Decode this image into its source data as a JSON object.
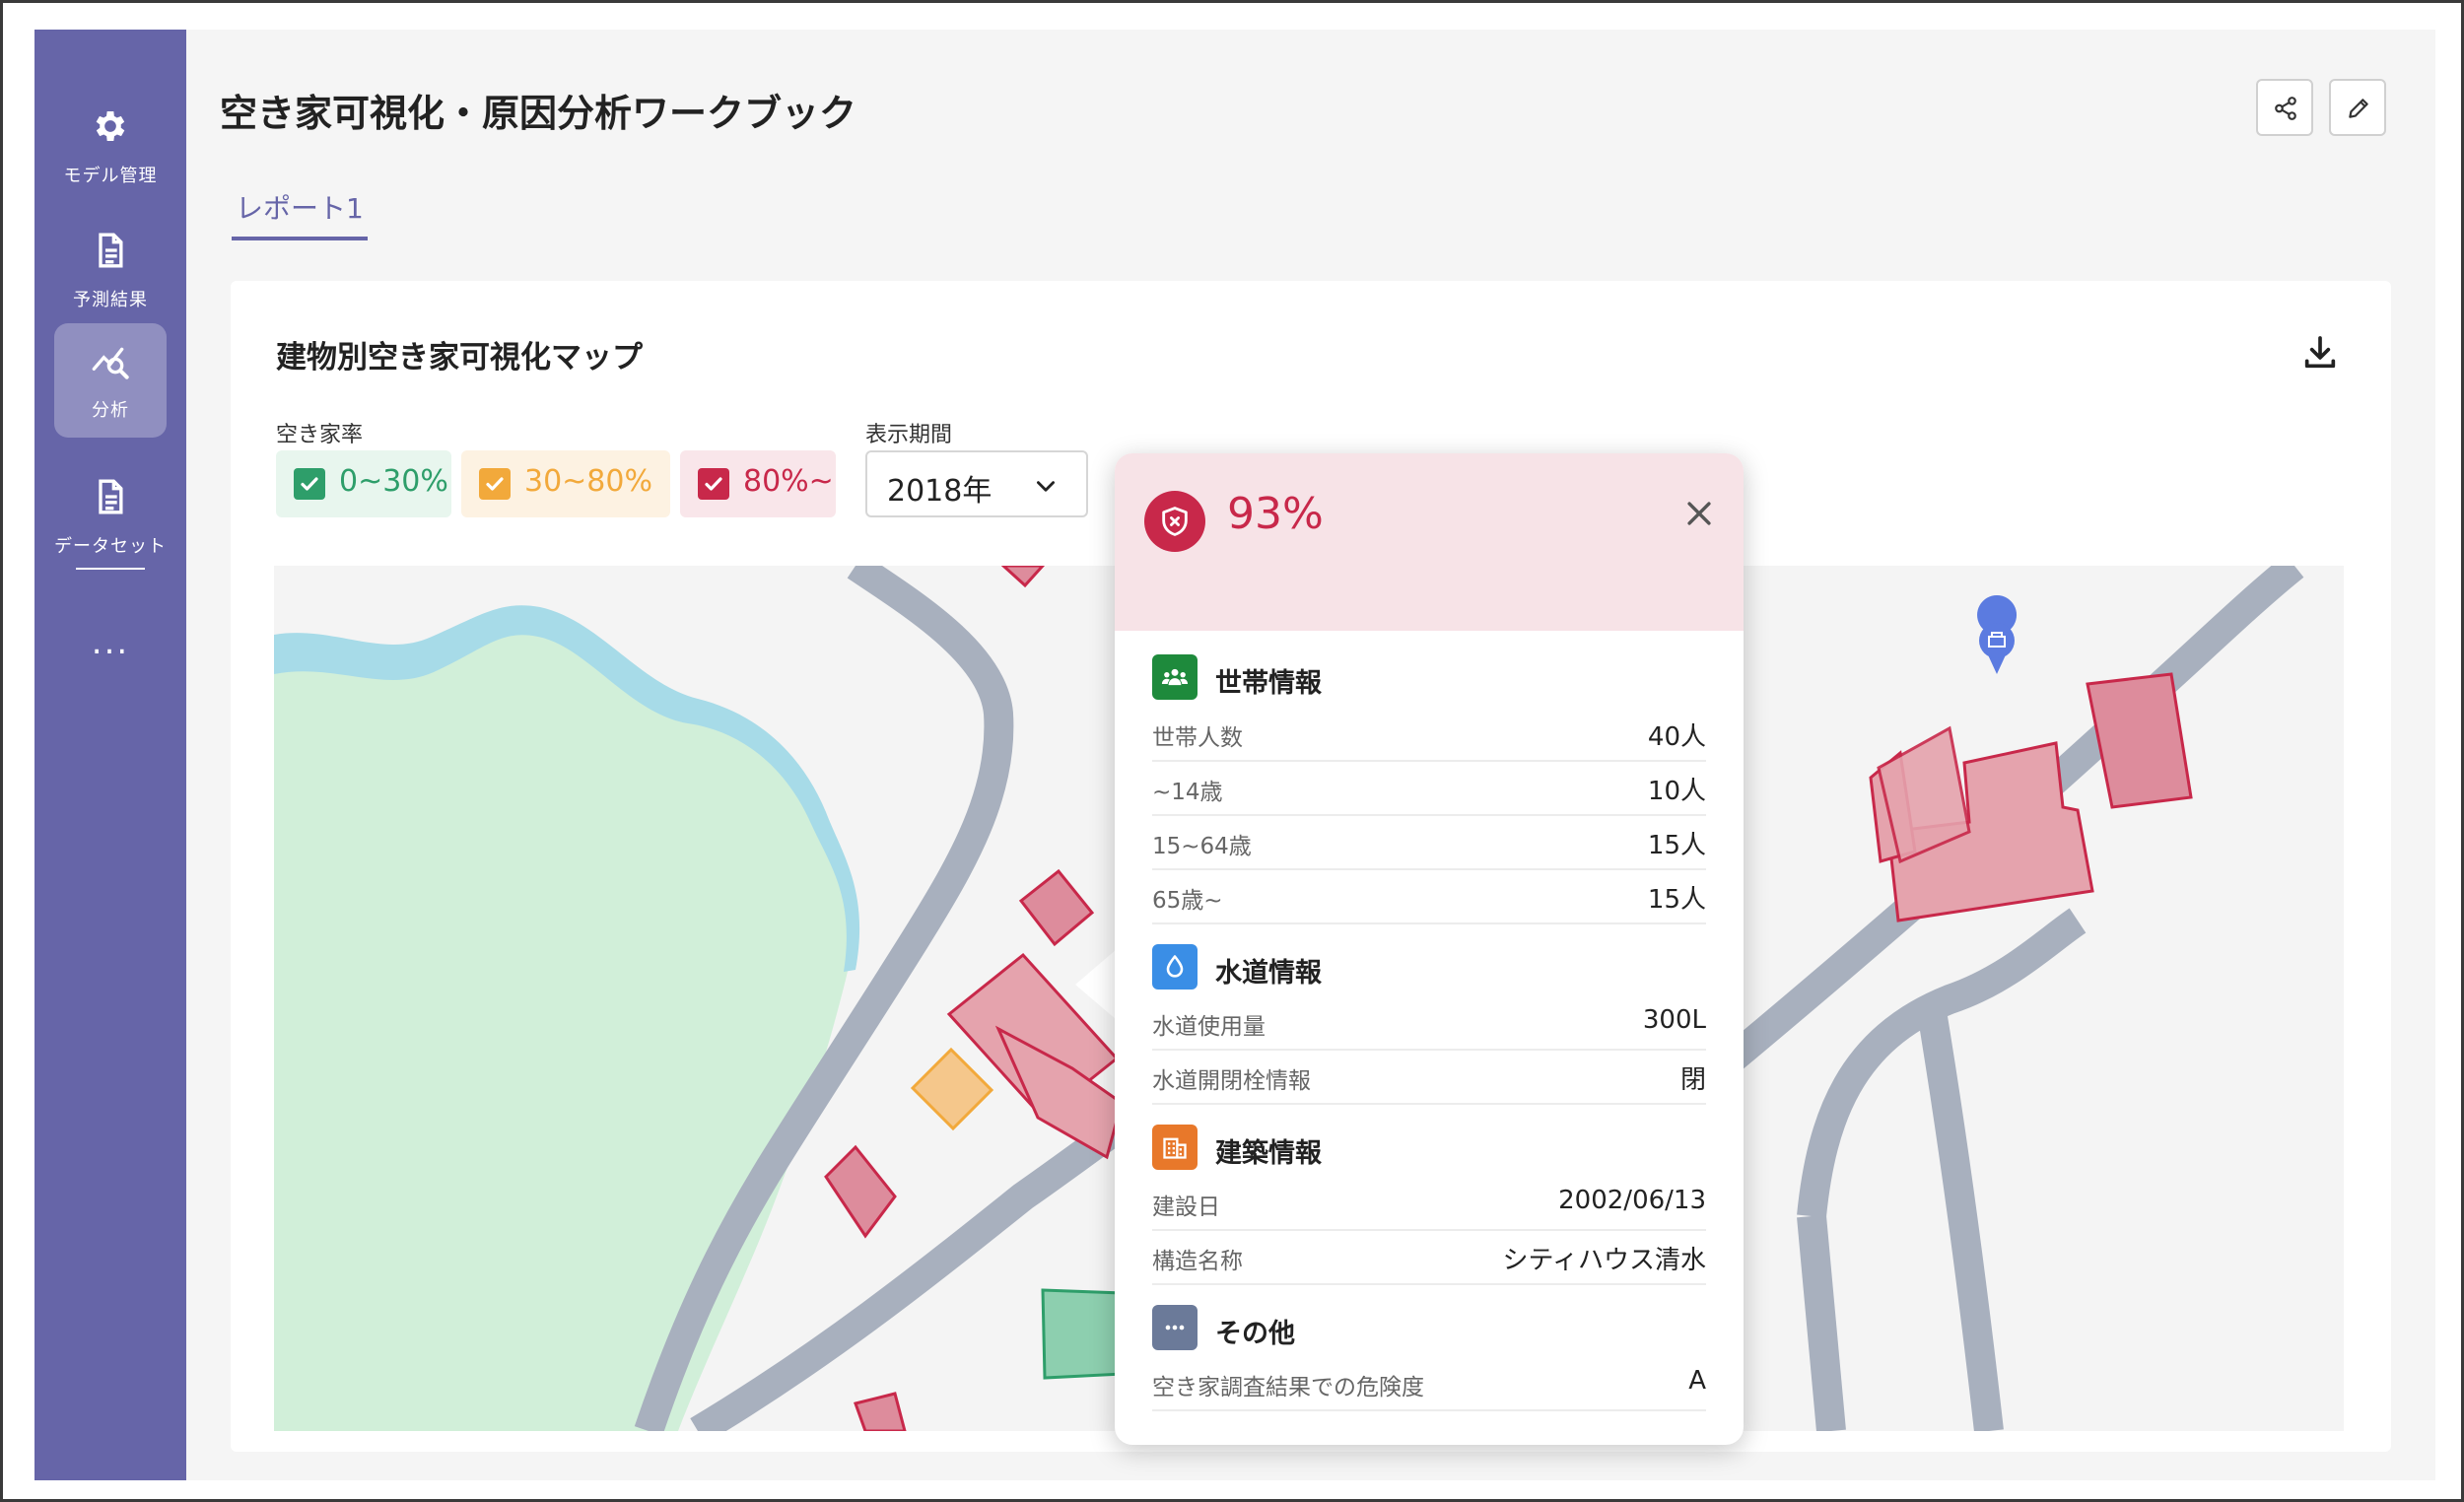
{
  "sidebar": {
    "items": [
      {
        "label": "モデル管理",
        "icon": "gear-icon"
      },
      {
        "label": "予測結果",
        "icon": "document-icon"
      },
      {
        "label": "分析",
        "icon": "analytics-icon",
        "active": true
      },
      {
        "label": "データセット",
        "icon": "dataset-icon"
      }
    ],
    "more_label": "..."
  },
  "header": {
    "title": "空き家可視化・原因分析ワークブック",
    "share_icon": "share-icon",
    "edit_icon": "edit-icon"
  },
  "tabs": [
    {
      "label": "レポート1",
      "active": true
    }
  ],
  "card": {
    "title": "建物別空き家可視化マップ",
    "download_icon": "download-icon",
    "filters": {
      "vacancy_label": "空き家率",
      "chips": [
        {
          "label": "0~30%",
          "checked": true,
          "color": "#2e9e6a",
          "bg": "#e8f6ee"
        },
        {
          "label": "30~80%",
          "checked": true,
          "color": "#f2a93b",
          "bg": "#fdf2e2"
        },
        {
          "label": "80%~",
          "checked": true,
          "color": "#c8284a",
          "bg": "#f9e6ea"
        }
      ],
      "period_label": "表示期間",
      "period_value": "2018年"
    }
  },
  "popup": {
    "risk_value": "93%",
    "risk_color": "#c8284a",
    "sections": [
      {
        "title": "世帯情報",
        "icon": "people-icon",
        "color": "#1e8a3c",
        "rows": [
          {
            "key": "世帯人数",
            "value": "40人"
          },
          {
            "key": "~14歳",
            "value": "10人"
          },
          {
            "key": "15~64歳",
            "value": "15人"
          },
          {
            "key": "65歳~",
            "value": "15人"
          }
        ]
      },
      {
        "title": "水道情報",
        "icon": "water-drop-icon",
        "color": "#3a8ee6",
        "rows": [
          {
            "key": "水道使用量",
            "value": "300L"
          },
          {
            "key": "水道開閉栓情報",
            "value": "閉"
          }
        ]
      },
      {
        "title": "建築情報",
        "icon": "building-icon",
        "color": "#e8782a",
        "rows": [
          {
            "key": "建設日",
            "value": "2002/06/13"
          },
          {
            "key": "構造名称",
            "value": "シティハウス清水"
          }
        ]
      },
      {
        "title": "その他",
        "icon": "more-icon",
        "color": "#6b7a99",
        "rows": [
          {
            "key": "空き家調査結果での危険度",
            "value": "A"
          }
        ]
      }
    ]
  },
  "colors": {
    "sidebar": "#6665a8",
    "accent": "#6665a8",
    "high": "#c8284a",
    "mid": "#f2a93b",
    "low": "#2e9e6a"
  }
}
